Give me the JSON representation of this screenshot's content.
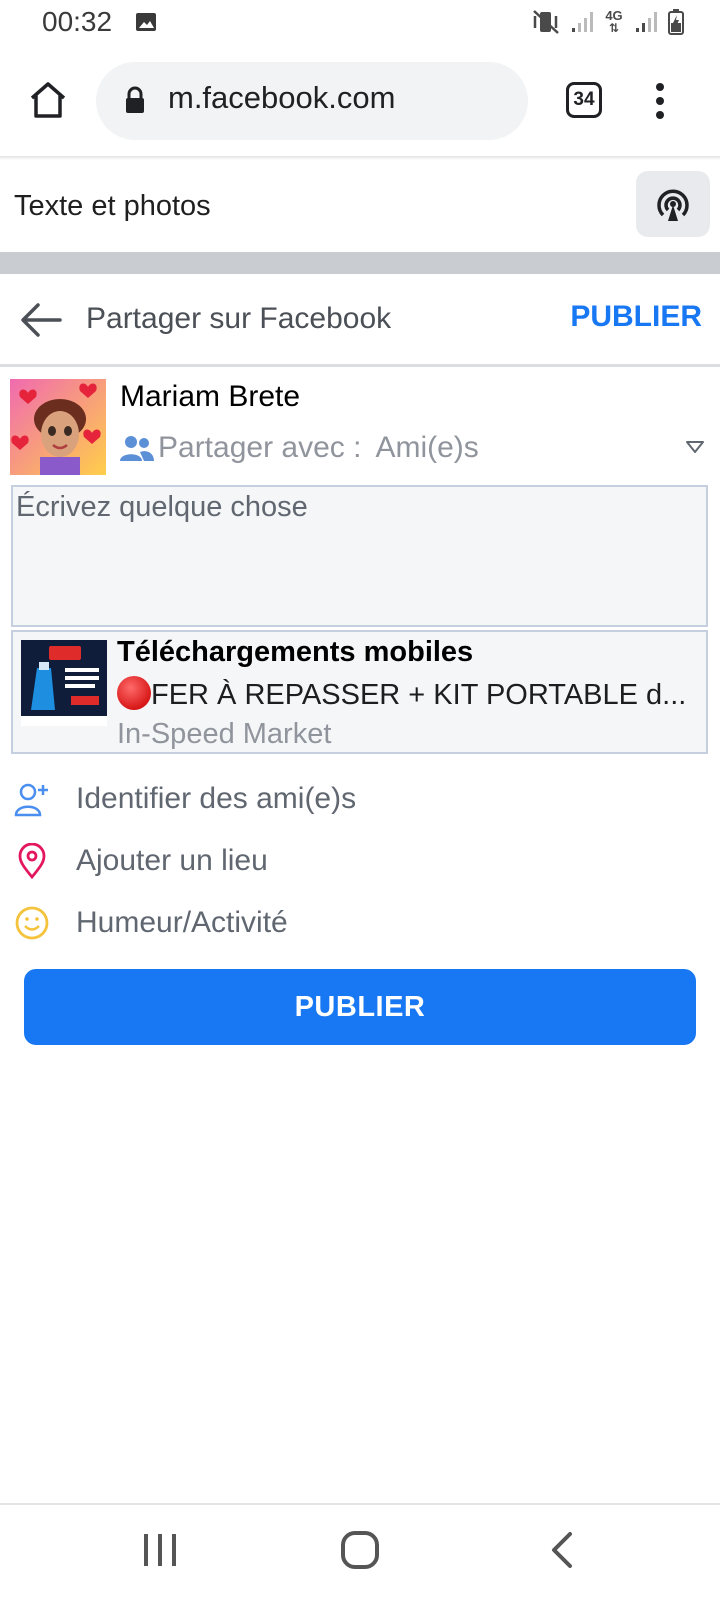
{
  "status_bar": {
    "time": "00:32",
    "network": "4G"
  },
  "browser": {
    "url": "m.facebook.com",
    "tab_count": "34"
  },
  "reader": {
    "title": "Texte et photos"
  },
  "composer": {
    "header_title": "Partager sur Facebook",
    "publish_label": "PUBLIER",
    "user_name": "Mariam Brete",
    "audience_label": "Partager avec :",
    "audience_value": "Ami(e)s",
    "text_placeholder": "Écrivez quelque chose",
    "attachment": {
      "title": "Téléchargements mobiles",
      "description": "FER À REPASSER + KIT PORTABLE d...",
      "source": "In-Speed Market"
    },
    "options": [
      {
        "label": "Identifier des ami(e)s",
        "icon": "tag-friends-icon"
      },
      {
        "label": "Ajouter un lieu",
        "icon": "location-pin-icon"
      },
      {
        "label": "Humeur/Activité",
        "icon": "smiley-icon"
      }
    ],
    "publish_button": "PUBLIER"
  },
  "colors": {
    "accent": "#1877f2",
    "muted_text": "#90949c",
    "location_icon": "#e4165f",
    "mood_icon": "#f5c33b"
  }
}
